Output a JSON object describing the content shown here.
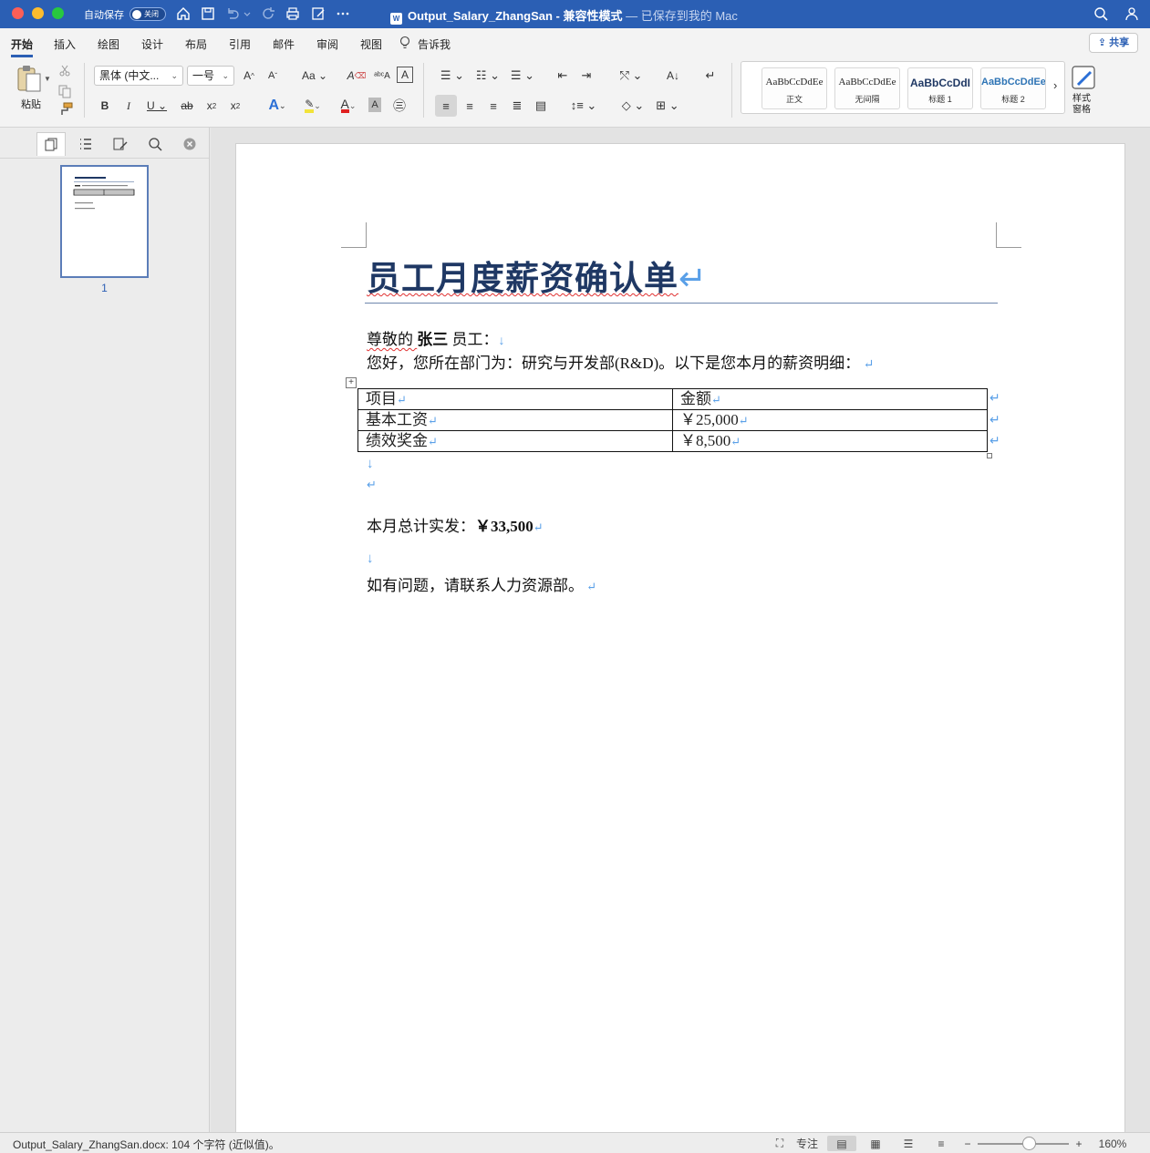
{
  "titlebar": {
    "autosave_label": "自动保存",
    "autosave_state": "关闭",
    "filename": "Output_Salary_ZhangSan",
    "mode": "- 兼容性模式",
    "save_status": "— 已保存到我的 Mac"
  },
  "ribbon_tabs": [
    "开始",
    "插入",
    "绘图",
    "设计",
    "布局",
    "引用",
    "邮件",
    "审阅",
    "视图",
    "告诉我"
  ],
  "share_label": "共享",
  "toolbar": {
    "paste_label": "粘贴",
    "font_name": "黑体 (中文...",
    "font_size": "一号",
    "styles": [
      {
        "sample": "AaBbCcDdEe",
        "name": "正文"
      },
      {
        "sample": "AaBbCcDdEe",
        "name": "无间隔"
      },
      {
        "sample": "AaBbCcDdI",
        "name": "标题 1"
      },
      {
        "sample": "AaBbCcDdEe",
        "name": "标题 2"
      }
    ],
    "styles_pane_label": "样式\n窗格"
  },
  "nav": {
    "page_number": "1"
  },
  "document": {
    "title": "员工月度薪资确认单",
    "greeting_prefix": "尊敬的 ",
    "employee_name": "张三",
    "greeting_suffix": " 员工：",
    "intro": "您好，您所在部门为：研究与开发部(R&D)。以下是您本月的薪资明细：",
    "table": {
      "headers": [
        "项目",
        "金额"
      ],
      "rows": [
        [
          "基本工资",
          "￥25,000"
        ],
        [
          "绩效奖金",
          "￥8,500"
        ]
      ]
    },
    "total_label": "本月总计实发：",
    "total_value": "￥33,500",
    "closing": "如有问题，请联系人力资源部。"
  },
  "statusbar": {
    "text": "Output_Salary_ZhangSan.docx: 104 个字符 (近似值)。",
    "focus_label": "专注",
    "zoom": "160%"
  }
}
